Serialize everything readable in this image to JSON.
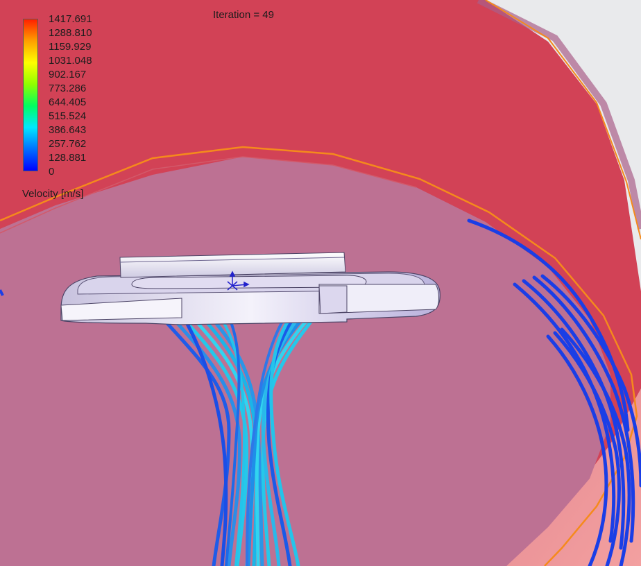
{
  "legend": {
    "tick_labels": [
      "1417.691",
      "1288.810",
      "1159.929",
      "1031.048",
      "902.167",
      "773.286",
      "644.405",
      "515.524",
      "386.643",
      "257.762",
      "128.881",
      "0"
    ],
    "unit_label": "Velocity [m/s]",
    "colormap": [
      "#0000ff",
      "#0070ff",
      "#00e8ff",
      "#00ff60",
      "#90ff00",
      "#ffff00",
      "#ffa000",
      "#ff2000"
    ]
  },
  "status": {
    "iteration_label": "Iteration = ",
    "iteration_value": "49"
  },
  "colors": {
    "outer_domain": "#d24256",
    "inner_surface": "#bd7193",
    "domain_edge": "#f58a1c",
    "part_body": "#e8e4f4",
    "streamline_fast": "#25c8ea",
    "streamline_slow": "#1a3ee6",
    "background": "#e9eaec"
  }
}
